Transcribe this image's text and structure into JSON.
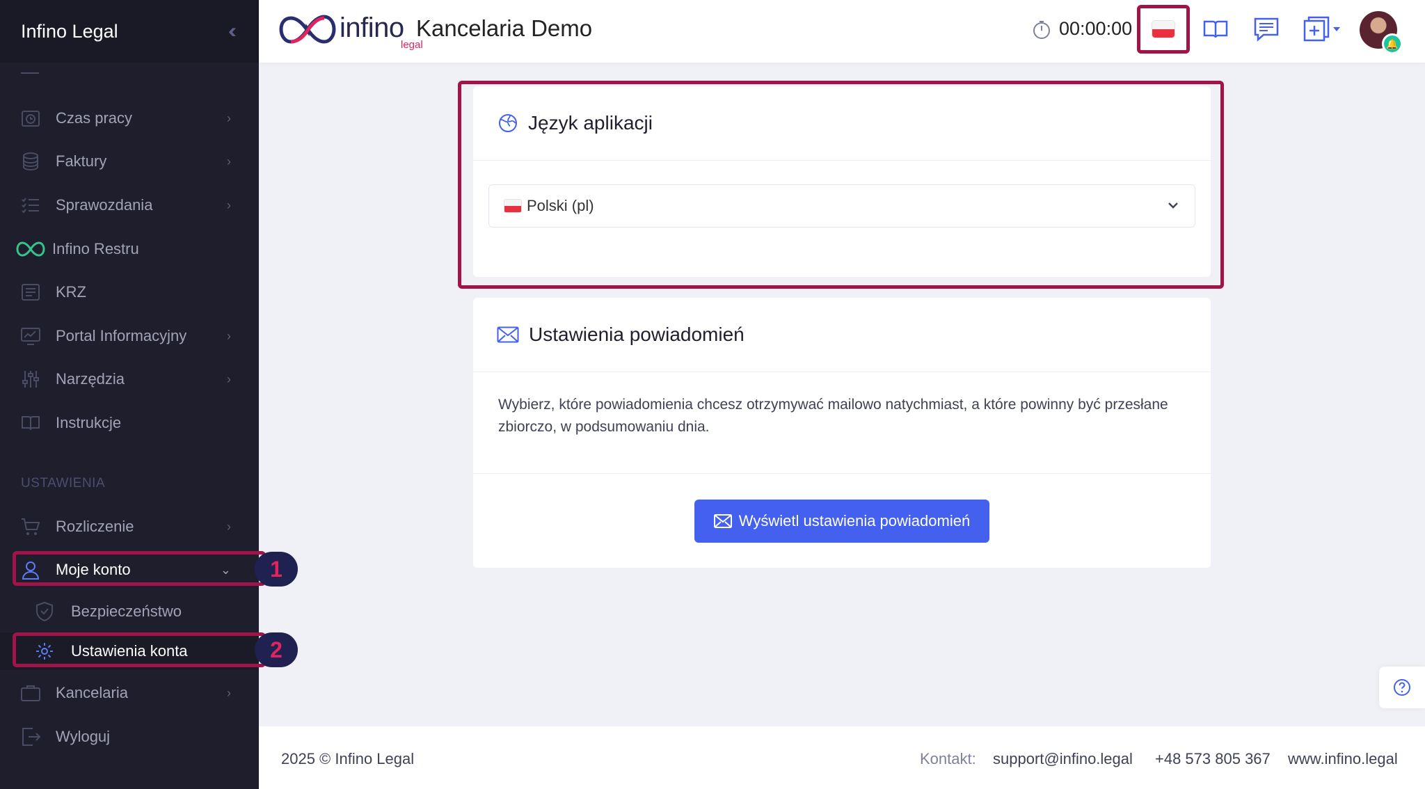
{
  "sidebar": {
    "brand": "Infino Legal",
    "items": [
      {
        "label": "Czas pracy"
      },
      {
        "label": "Faktury"
      },
      {
        "label": "Sprawozdania"
      },
      {
        "label": "Infino Restru"
      },
      {
        "label": "KRZ"
      },
      {
        "label": "Portal Informacyjny"
      },
      {
        "label": "Narzędzia"
      },
      {
        "label": "Instrukcje"
      }
    ],
    "section_label": "USTAWIENIA",
    "settings_items": [
      {
        "label": "Rozliczenie"
      },
      {
        "label": "Moje konto"
      },
      {
        "label": "Bezpieczeństwo"
      },
      {
        "label": "Ustawienia konta"
      },
      {
        "label": "Kancelaria"
      },
      {
        "label": "Wyloguj"
      }
    ],
    "badges": [
      "1",
      "2"
    ]
  },
  "header": {
    "logo_text": "infino",
    "logo_sub": "legal",
    "title": "Kancelaria Demo",
    "timer": "00:00:00"
  },
  "language_card": {
    "title": "Język aplikacji",
    "selected": "Polski (pl)"
  },
  "notifications_card": {
    "title": "Ustawienia powiadomień",
    "description": "Wybierz, które powiadomienia chcesz otrzymywać mailowo natychmiast, a które powinny być przesłane zbiorczo, w podsumowaniu dnia.",
    "button_label": "Wyświetl ustawienia powiadomień"
  },
  "footer": {
    "copyright": "2025 © Infino Legal",
    "contact_label": "Kontakt:",
    "email": "support@infino.legal",
    "phone": "+48 573 805 367",
    "website": "www.infino.legal"
  },
  "colors": {
    "sidebar_bg": "#1e1e2d",
    "accent_primary": "#4361ee",
    "highlight": "#a0144a",
    "badge_bg": "#1f2250",
    "badge_text": "#e0245e"
  }
}
